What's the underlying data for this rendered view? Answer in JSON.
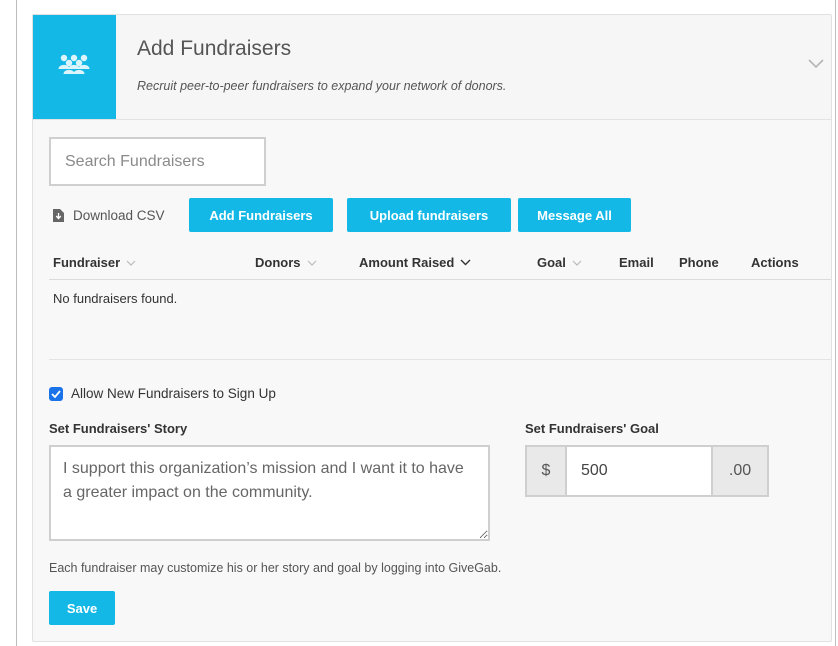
{
  "colors": {
    "accent": "#14b8e6",
    "checkbox": "#1a73e8"
  },
  "header": {
    "icon": "users-group-icon",
    "title": "Add Fundraisers",
    "subtitle": "Recruit peer-to-peer fundraisers to expand your network of donors."
  },
  "search": {
    "placeholder": "Search Fundraisers",
    "value": ""
  },
  "toolbar": {
    "download_label": "Download CSV",
    "add_label": "Add Fundraisers",
    "upload_label": "Upload fundraisers",
    "message_label": "Message All"
  },
  "table": {
    "columns": [
      "Fundraiser",
      "Donors",
      "Amount Raised",
      "Goal",
      "Email",
      "Phone",
      "Actions"
    ],
    "empty_text": "No fundraisers found."
  },
  "settings": {
    "allow_signup_label": "Allow New Fundraisers to Sign Up",
    "allow_signup_checked": true,
    "story_label": "Set Fundraisers' Story",
    "story_value": "I support this organization’s mission and I want it to have a greater impact on the community.",
    "goal_label": "Set Fundraisers' Goal",
    "goal_prefix": "$",
    "goal_value": "500",
    "goal_suffix": ".00",
    "help_text": "Each fundraiser may customize his or her story and goal by logging into GiveGab.",
    "save_label": "Save"
  }
}
